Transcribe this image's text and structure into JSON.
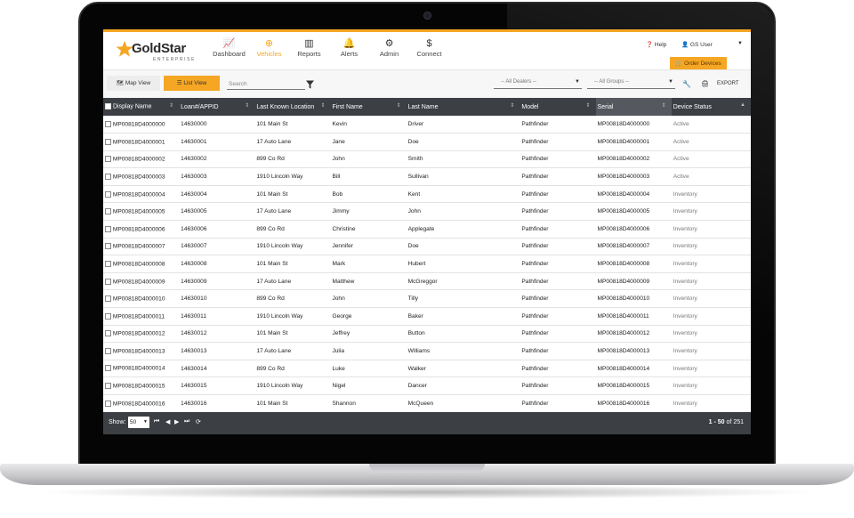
{
  "logo": {
    "name": "GoldStar",
    "sub": "ENTERPRISE"
  },
  "nav": [
    {
      "label": "Dashboard",
      "icon": "chart-line-icon",
      "glyph": "📈"
    },
    {
      "label": "Vehicles",
      "icon": "plus-circle-icon",
      "glyph": "⊕"
    },
    {
      "label": "Reports",
      "icon": "bar-chart-icon",
      "glyph": "▥"
    },
    {
      "label": "Alerts",
      "icon": "bell-icon",
      "glyph": "🔔"
    },
    {
      "label": "Admin",
      "icon": "gear-icon",
      "glyph": "⚙"
    },
    {
      "label": "Connect",
      "icon": "dollar-icon",
      "glyph": "$"
    }
  ],
  "active_nav": "Vehicles",
  "header": {
    "help": "Help",
    "user": "GS User",
    "order_devices": "Order Devices"
  },
  "toolbar": {
    "map_view": "Map View",
    "list_view": "List View",
    "search_placeholder": "Search",
    "dealers_placeholder": "-- All Dealers --",
    "groups_placeholder": "-- All Groups --",
    "export": "EXPORT"
  },
  "table": {
    "columns": [
      "Display Name",
      "Loan#/APPID",
      "Last Known Location",
      "First Name",
      "Last Name",
      "Model",
      "Serial",
      "Device Status"
    ],
    "rows": [
      [
        "MP00818D4000000",
        "14630000",
        "101 Main St",
        "Kevin",
        "Driver",
        "Pathfinder",
        "MP00818D4000000",
        "Active"
      ],
      [
        "MP00818D4000001",
        "14630001",
        "17 Auto Lane",
        "Jane",
        "Doe",
        "Pathfinder",
        "MP00818D4000001",
        "Active"
      ],
      [
        "MP00818D4000002",
        "14630002",
        "899 Co Rd",
        "John",
        "Smith",
        "Pathfinder",
        "MP00818D4000002",
        "Active"
      ],
      [
        "MP00818D4000003",
        "14630003",
        "1910 Lincoln Way",
        "Bill",
        "Sullivan",
        "Pathfinder",
        "MP00818D4000003",
        "Active"
      ],
      [
        "MP00818D4000004",
        "14630004",
        "101 Main St",
        "Bob",
        "Kent",
        "Pathfinder",
        "MP00818D4000004",
        "Inventory"
      ],
      [
        "MP00818D4000005",
        "14630005",
        "17 Auto Lane",
        "Jimmy",
        "John",
        "Pathfinder",
        "MP00818D4000005",
        "Inventory"
      ],
      [
        "MP00818D4000006",
        "14630006",
        "899 Co Rd",
        "Christine",
        "Applegate",
        "Pathfinder",
        "MP00818D4000006",
        "Inventory"
      ],
      [
        "MP00818D4000007",
        "14630007",
        "1910 Lincoln Way",
        "Jennifer",
        "Doe",
        "Pathfinder",
        "MP00818D4000007",
        "Inventory"
      ],
      [
        "MP00818D4000008",
        "14630008",
        "101 Main St",
        "Mark",
        "Hubert",
        "Pathfinder",
        "MP00818D4000008",
        "Inventory"
      ],
      [
        "MP00818D4000009",
        "14630009",
        "17 Auto Lane",
        "Matthew",
        "McGreggor",
        "Pathfinder",
        "MP00818D4000009",
        "Inventory"
      ],
      [
        "MP00818D4000010",
        "14630010",
        "899 Co Rd",
        "John",
        "Tilly",
        "Pathfinder",
        "MP00818D4000010",
        "Inventory"
      ],
      [
        "MP00818D4000011",
        "14630011",
        "1910 Lincoln Way",
        "George",
        "Baker",
        "Pathfinder",
        "MP00818D4000011",
        "Inventory"
      ],
      [
        "MP00818D4000012",
        "14630012",
        "101 Main St",
        "Jeffrey",
        "Button",
        "Pathfinder",
        "MP00818D4000012",
        "Inventory"
      ],
      [
        "MP00818D4000013",
        "14630013",
        "17 Auto Lane",
        "Julia",
        "Williams",
        "Pathfinder",
        "MP00818D4000013",
        "Inventory"
      ],
      [
        "MP00818D4000014",
        "14630014",
        "899 Co Rd",
        "Luke",
        "Walker",
        "Pathfinder",
        "MP00818D4000014",
        "Inventory"
      ],
      [
        "MP00818D4000015",
        "14630015",
        "1910 Lincoln Way",
        "Nigel",
        "Dancer",
        "Pathfinder",
        "MP00818D4000015",
        "Inventory"
      ],
      [
        "MP00818D4000016",
        "14630016",
        "101 Main St",
        "Shannon",
        "McQueen",
        "Pathfinder",
        "MP00818D4000016",
        "Inventory"
      ]
    ]
  },
  "footer": {
    "show_label": "Show:",
    "page_size": "50",
    "range": "1 - 50",
    "of_label": "of 251"
  },
  "colors": {
    "accent": "#f5a623",
    "header_bg": "#3c3f44"
  }
}
